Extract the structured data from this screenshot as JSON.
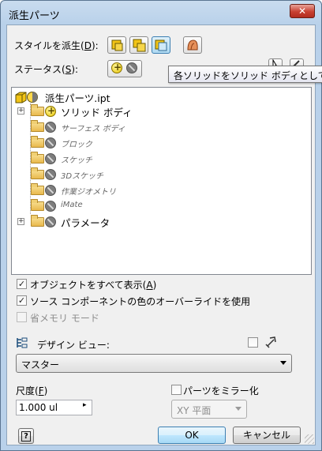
{
  "window": {
    "title": "派生パーツ",
    "close_label": "✕"
  },
  "style_row": {
    "label": "スタイルを派生(",
    "accel": "D",
    "label_end": "):",
    "buttons": [
      "style-solid-body-icon",
      "style-single-composite-icon",
      "style-separate-solid-icons",
      "style-surface-icon"
    ]
  },
  "status_row": {
    "label": "ステータス(",
    "accel": "S",
    "label_end": "):"
  },
  "tooltip": {
    "text": "各ソリッドをソリッド ボディとして"
  },
  "tree": {
    "root": "派生パーツ.ipt",
    "items": [
      {
        "label": "ソリッド ボディ",
        "expandable": true,
        "status": "include",
        "style": "main"
      },
      {
        "label": "サーフェス ボディ",
        "expandable": false,
        "status": "exclude",
        "style": "sub"
      },
      {
        "label": "ブロック",
        "expandable": false,
        "status": "exclude",
        "style": "sub"
      },
      {
        "label": "スケッチ",
        "expandable": false,
        "status": "exclude",
        "style": "sub"
      },
      {
        "label": "3Dスケッチ",
        "expandable": false,
        "status": "exclude",
        "style": "sub"
      },
      {
        "label": "作業ジオメトリ",
        "expandable": false,
        "status": "exclude",
        "style": "sub"
      },
      {
        "label": "iMate",
        "expandable": false,
        "status": "exclude",
        "style": "sub"
      },
      {
        "label": "パラメータ",
        "expandable": true,
        "status": "exclude",
        "style": "main"
      }
    ]
  },
  "options": {
    "show_all": {
      "label": "オブジェクトをすべて表示(",
      "accel": "A",
      "end": ")",
      "checked": true
    },
    "color_override": {
      "label": "ソース コンポーネントの色のオーバーライドを使用",
      "checked": true
    },
    "reduced_memory": {
      "label": "省メモリ モード",
      "checked": false,
      "disabled": true
    }
  },
  "design_view": {
    "label": "デザイン ビュー:",
    "selected": "マスター"
  },
  "scale": {
    "label": "尺度(",
    "accel": "F",
    "end": ")",
    "value": "1.000 ul"
  },
  "mirror": {
    "label": "パーツをミラー化",
    "checked": false,
    "plane": "XY 平面"
  },
  "buttons": {
    "help": "?",
    "ok": "OK",
    "cancel": "キャンセル"
  },
  "colors": {
    "title_gradient": "#b9d1ea",
    "dialog_bg": "#f0f0f0",
    "close_red": "#c84031",
    "include_yellow": "#e8c400",
    "exclude_gray": "#7d7d7d"
  }
}
